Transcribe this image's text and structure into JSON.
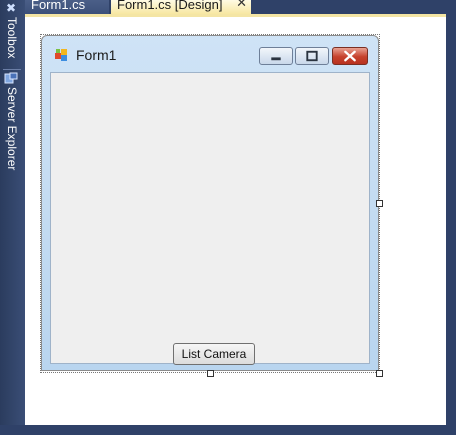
{
  "ide": {
    "tabs": [
      {
        "label": "Form1.cs",
        "active": false
      },
      {
        "label": "Form1.cs [Design]",
        "active": true
      }
    ],
    "tab_close_glyph": "✕",
    "side_tabs": [
      {
        "label": "Toolbox",
        "icon": "toolbox-icon"
      },
      {
        "label": "Server Explorer",
        "icon": "server-explorer-icon"
      }
    ]
  },
  "form": {
    "title": "Form1",
    "icon": "form-app-icon",
    "caption_buttons": [
      "minimize-icon",
      "maximize-icon",
      "close-icon"
    ]
  },
  "controls": {
    "list_camera_button": "List Camera"
  },
  "colors": {
    "ide_chrome": "#2f4168",
    "active_tab": "#f7e7a2",
    "close_button": "#c6412c",
    "form_frame": "#b9d5ef",
    "client_area": "#efefef"
  }
}
